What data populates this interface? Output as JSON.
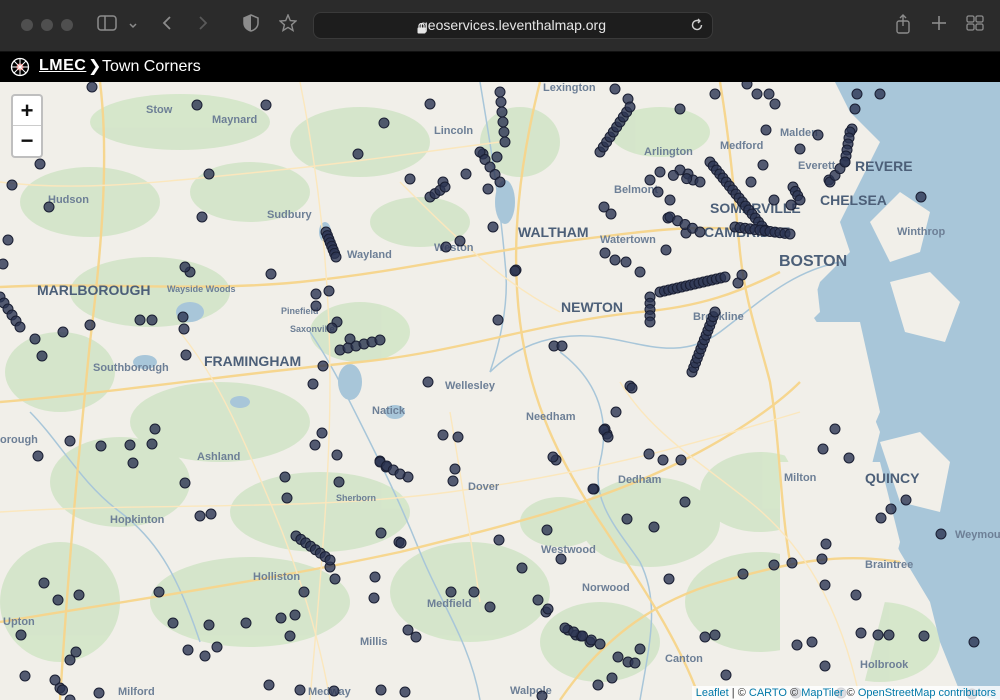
{
  "browser": {
    "url": "geoservices.leventhalmap.org",
    "icons": [
      "window-close-dot",
      "window-minimize-dot",
      "window-zoom-dot",
      "sidebar-icon",
      "chevron-down-icon",
      "back-icon",
      "forward-icon",
      "shield-icon",
      "star-icon",
      "lock-icon",
      "reload-icon",
      "share-icon",
      "new-tab-icon",
      "tab-overview-icon"
    ]
  },
  "header": {
    "app_name": "LMEC",
    "separator": "❯",
    "page_title": "Town Corners"
  },
  "map": {
    "zoom_in": "+",
    "zoom_out": "−",
    "labels": {
      "lexington": "Lexington",
      "stow": "Stow",
      "maynard": "Maynard",
      "lincoln": "Lincoln",
      "arlington": "Arlington",
      "medford": "Medford",
      "malden": "Malden",
      "everett": "Everett",
      "revere": "REVERE",
      "hudson": "Hudson",
      "sudbury": "Sudbury",
      "belmont": "Belmont",
      "somerville": "SOMERVILLE",
      "chelsea": "CHELSEA",
      "waltham": "WALTHAM",
      "watertown": "Watertown",
      "cambridge": "CAMBRIDGE",
      "winthrop": "Winthrop",
      "wayland": "Wayland",
      "weston": "Weston",
      "boston": "BOSTON",
      "marlborough": "MARLBOROUGH",
      "wayside_woods": "Wayside Woods",
      "newton": "NEWTON",
      "pinefield": "Pinefield",
      "saxonville": "Saxonville",
      "brookline": "Brookline",
      "southborough": "Southborough",
      "framingham": "FRAMINGHAM",
      "wellesley": "Wellesley",
      "natick": "Natick",
      "needham": "Needham",
      "borough": "orough",
      "ashland": "Ashland",
      "dover": "Dover",
      "sherborn": "Sherborn",
      "dedham": "Dedham",
      "milton": "Milton",
      "quincy": "QUINCY",
      "hopkinton": "Hopkinton",
      "westwood": "Westwood",
      "weymouth": "Weymou",
      "holliston": "Holliston",
      "norwood": "Norwood",
      "braintree": "Braintree",
      "upton": "Upton",
      "medfield": "Medfield",
      "millis": "Millis",
      "canton": "Canton",
      "holbrook": "Holbrook",
      "milford": "Milford",
      "medway": "Medway",
      "walpole": "Walpole"
    },
    "attribution": {
      "leaflet": "Leaflet",
      "sep1": " | © ",
      "carto": "CARTO",
      "sep2": " © ",
      "maptiler": "MapTiler",
      "sep3": " © ",
      "osm": "OpenStreetMap contributors"
    },
    "marker_color": "#2c3553",
    "marker_count": 376
  }
}
